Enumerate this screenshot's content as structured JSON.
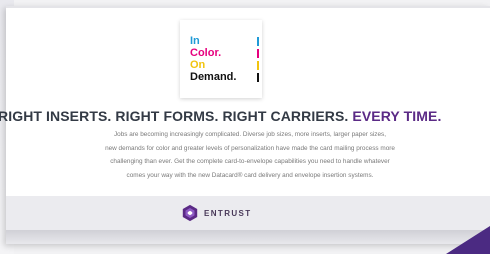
{
  "cover": {
    "line1": "In",
    "line2": "Color.",
    "line3": "On",
    "line4": "Demand."
  },
  "headline": {
    "main": "RIGHT INSERTS. RIGHT FORMS. RIGHT CARRIERS. ",
    "accent": "EVERY TIME."
  },
  "body": {
    "line1": "Jobs are becoming increasingly complicated. Diverse job sizes, more inserts, larger paper sizes,",
    "line2": "new demands for color and greater levels of personalization have made the card mailing process more",
    "line3": "challenging than ever. Get the complete card-to-envelope capabilities you need to handle whatever",
    "line4": "comes your way with the new Datacard® card delivery and envelope insertion systems."
  },
  "footer": {
    "logo_text": "ENTRUST"
  },
  "colors": {
    "accent_purple": "#5b2a86",
    "cyan": "#1f9ad6",
    "magenta": "#e6007e",
    "yellow": "#f1c40f",
    "corner": "#4b2a82"
  }
}
